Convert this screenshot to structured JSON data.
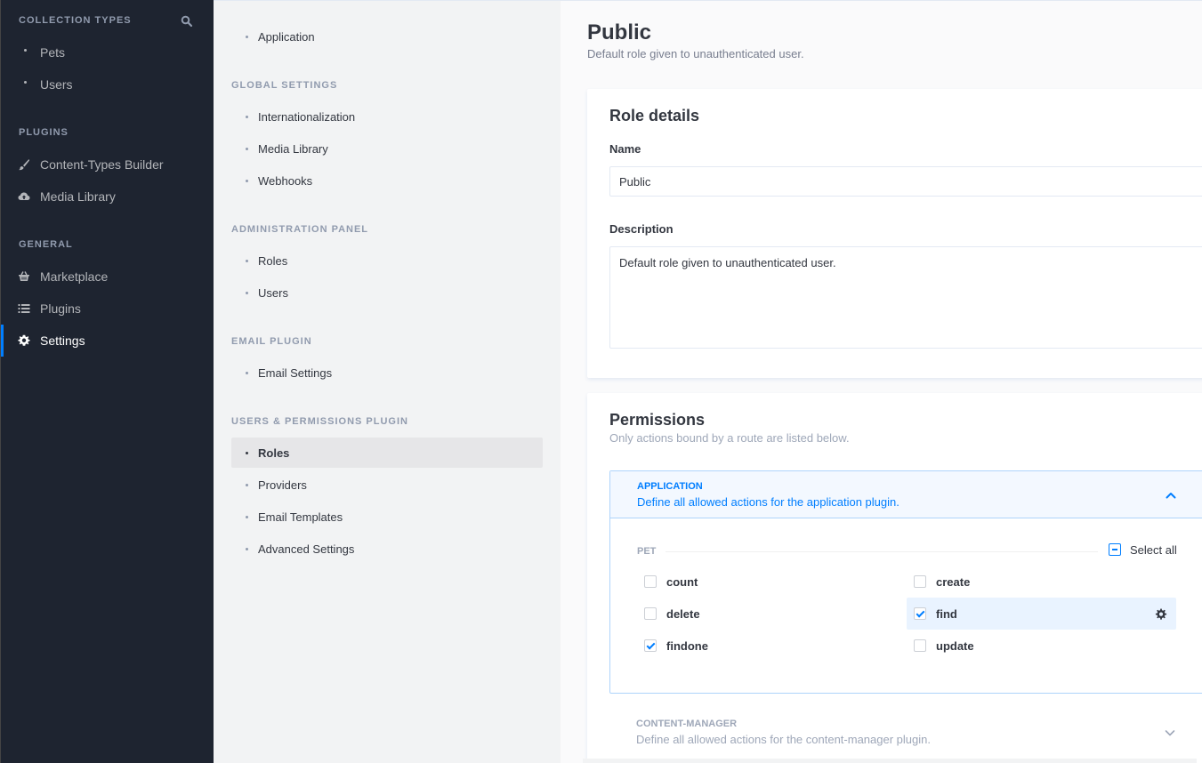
{
  "sidebar": {
    "collection_types_title": "Collection Types",
    "collection_items": [
      {
        "label": "Pets"
      },
      {
        "label": "Users"
      }
    ],
    "plugins_title": "Plugins",
    "plugin_items": [
      {
        "label": "Content-Types Builder",
        "icon": "paintbrush-icon"
      },
      {
        "label": "Media Library",
        "icon": "cloud-upload-icon"
      }
    ],
    "general_title": "General",
    "general_items": [
      {
        "label": "Marketplace",
        "icon": "basket-icon"
      },
      {
        "label": "Plugins",
        "icon": "list-icon"
      },
      {
        "label": "Settings",
        "icon": "gear-icon",
        "active": true
      }
    ]
  },
  "settings_nav": {
    "top_items": [
      {
        "label": "Application"
      }
    ],
    "global_title": "Global Settings",
    "global_items": [
      {
        "label": "Internationalization"
      },
      {
        "label": "Media Library"
      },
      {
        "label": "Webhooks"
      }
    ],
    "admin_title": "Administration Panel",
    "admin_items": [
      {
        "label": "Roles"
      },
      {
        "label": "Users"
      }
    ],
    "email_title": "Email Plugin",
    "email_items": [
      {
        "label": "Email Settings"
      }
    ],
    "up_title": "Users & Permissions Plugin",
    "up_items": [
      {
        "label": "Roles",
        "active": true
      },
      {
        "label": "Providers"
      },
      {
        "label": "Email Templates"
      },
      {
        "label": "Advanced Settings"
      }
    ]
  },
  "main": {
    "title": "Public",
    "subtitle": "Default role given to unauthenticated user.",
    "role_details": {
      "title": "Role details",
      "name_label": "Name",
      "name_value": "Public",
      "description_label": "Description",
      "description_value": "Default role given to unauthenticated user."
    },
    "permissions": {
      "title": "Permissions",
      "subtitle": "Only actions bound by a route are listed below.",
      "application": {
        "name": "Application",
        "description": "Define all allowed actions for the application plugin.",
        "content_type": "Pet",
        "select_all_label": "Select all",
        "actions": [
          {
            "label": "count",
            "checked": false
          },
          {
            "label": "create",
            "checked": false
          },
          {
            "label": "delete",
            "checked": false
          },
          {
            "label": "find",
            "checked": true,
            "highlight": true
          },
          {
            "label": "findone",
            "checked": true
          },
          {
            "label": "update",
            "checked": false
          }
        ]
      },
      "content_manager": {
        "name": "Content-Manager",
        "description": "Define all allowed actions for the content-manager plugin."
      }
    }
  },
  "colors": {
    "sidebar_bg": "#1e2430",
    "accent": "#007eff",
    "subnav_bg": "#f2f3f4"
  }
}
